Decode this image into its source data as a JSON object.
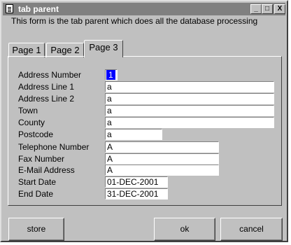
{
  "window": {
    "title": "tab parent",
    "controls": {
      "minimize": "_",
      "maximize": "□",
      "close": "X"
    }
  },
  "description": "This form is the tab parent which does all the database processing",
  "tabs": [
    {
      "label": "Page 1",
      "active": false
    },
    {
      "label": "Page 2",
      "active": false
    },
    {
      "label": "Page 3",
      "active": true
    }
  ],
  "form": {
    "fields": [
      {
        "label": "Address Number",
        "value": "1"
      },
      {
        "label": "Address Line 1",
        "value": "a"
      },
      {
        "label": "Address Line 2",
        "value": "a"
      },
      {
        "label": "Town",
        "value": "a"
      },
      {
        "label": "County",
        "value": "a"
      },
      {
        "label": "Postcode",
        "value": "a"
      },
      {
        "label": "Telephone Number",
        "value": "A"
      },
      {
        "label": "Fax Number",
        "value": "A"
      },
      {
        "label": "E-Mail Address",
        "value": "A"
      },
      {
        "label": "Start Date",
        "value": "01-DEC-2001"
      },
      {
        "label": "End Date",
        "value": "31-DEC-2001"
      }
    ]
  },
  "buttons": {
    "store": "store",
    "ok": "ok",
    "cancel": "cancel"
  },
  "colors": {
    "face": "#c0c0c0",
    "titlebar_inactive": "#808080",
    "selection": "#0000ff"
  }
}
